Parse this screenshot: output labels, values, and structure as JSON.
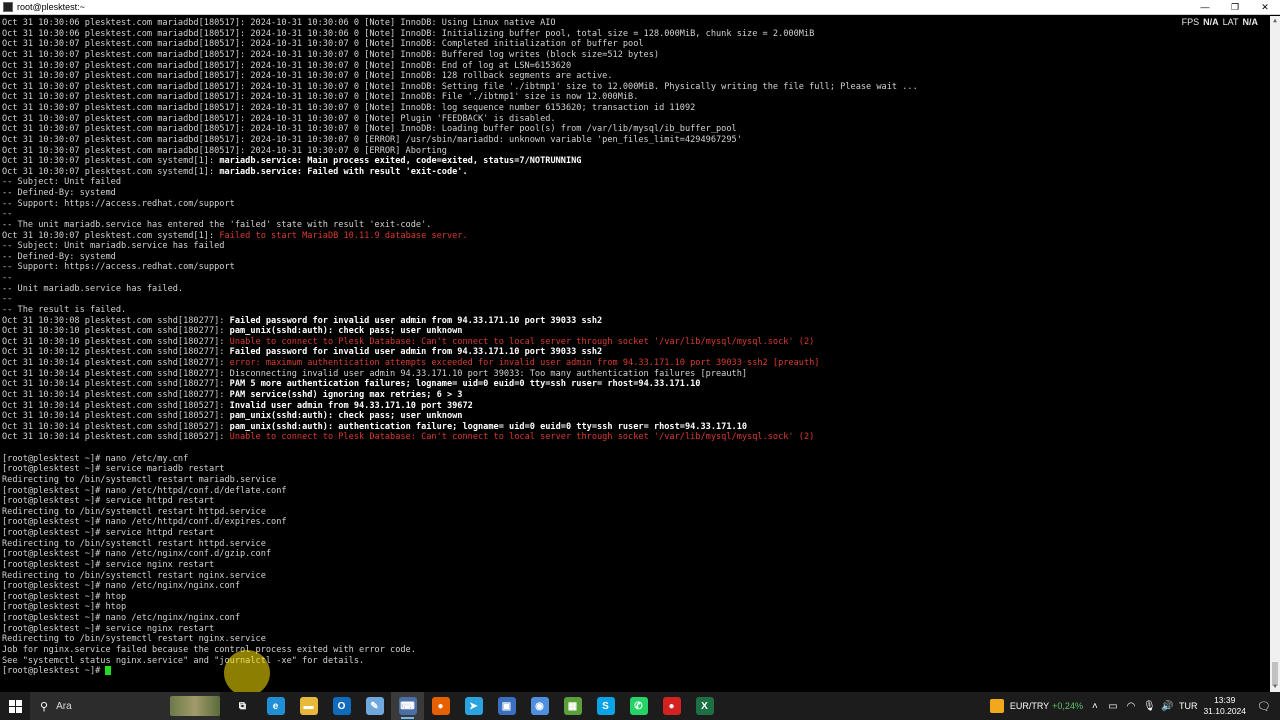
{
  "window": {
    "title": "root@plesktest:~",
    "minimize_glyph": "—",
    "maximize_glyph": "❐",
    "close_glyph": "✕"
  },
  "overlay": {
    "fps_label": "FPS",
    "fps_value": "N/A",
    "lat_label": "LAT",
    "lat_value": "N/A"
  },
  "terminal": {
    "lines": [
      [
        [
          "Oct 31 10:30:06 plesktest.com mariadbd[180517]: 2024-10-31 10:30:06 0 [Note] InnoDB: Using Linux native AIO",
          "n"
        ]
      ],
      [
        [
          "Oct 31 10:30:06 plesktest.com mariadbd[180517]: 2024-10-31 10:30:06 0 [Note] InnoDB: Initializing buffer pool, total size = 128.000MiB, chunk size = 2.000MiB",
          "n"
        ]
      ],
      [
        [
          "Oct 31 10:30:07 plesktest.com mariadbd[180517]: 2024-10-31 10:30:07 0 [Note] InnoDB: Completed initialization of buffer pool",
          "n"
        ]
      ],
      [
        [
          "Oct 31 10:30:07 plesktest.com mariadbd[180517]: 2024-10-31 10:30:07 0 [Note] InnoDB: Buffered log writes (block size=512 bytes)",
          "n"
        ]
      ],
      [
        [
          "Oct 31 10:30:07 plesktest.com mariadbd[180517]: 2024-10-31 10:30:07 0 [Note] InnoDB: End of log at LSN=6153620",
          "n"
        ]
      ],
      [
        [
          "Oct 31 10:30:07 plesktest.com mariadbd[180517]: 2024-10-31 10:30:07 0 [Note] InnoDB: 128 rollback segments are active.",
          "n"
        ]
      ],
      [
        [
          "Oct 31 10:30:07 plesktest.com mariadbd[180517]: 2024-10-31 10:30:07 0 [Note] InnoDB: Setting file './ibtmp1' size to 12.000MiB. Physically writing the file full; Please wait ...",
          "n"
        ]
      ],
      [
        [
          "Oct 31 10:30:07 plesktest.com mariadbd[180517]: 2024-10-31 10:30:07 0 [Note] InnoDB: File './ibtmp1' size is now 12.000MiB.",
          "n"
        ]
      ],
      [
        [
          "Oct 31 10:30:07 plesktest.com mariadbd[180517]: 2024-10-31 10:30:07 0 [Note] InnoDB: log sequence number 6153620; transaction id 11092",
          "n"
        ]
      ],
      [
        [
          "Oct 31 10:30:07 plesktest.com mariadbd[180517]: 2024-10-31 10:30:07 0 [Note] Plugin 'FEEDBACK' is disabled.",
          "n"
        ]
      ],
      [
        [
          "Oct 31 10:30:07 plesktest.com mariadbd[180517]: 2024-10-31 10:30:07 0 [Note] InnoDB: Loading buffer pool(s) from /var/lib/mysql/ib_buffer_pool",
          "n"
        ]
      ],
      [
        [
          "Oct 31 10:30:07 plesktest.com mariadbd[180517]: 2024-10-31 10:30:07 0 [ERROR] /usr/sbin/mariadbd: unknown variable 'pen_files_limit=4294967295'",
          "n"
        ]
      ],
      [
        [
          "Oct 31 10:30:07 plesktest.com mariadbd[180517]: 2024-10-31 10:30:07 0 [ERROR] Aborting",
          "n"
        ]
      ],
      [
        [
          "Oct 31 10:30:07 plesktest.com systemd[1]: ",
          "n"
        ],
        [
          "mariadb.service: Main process exited, code=exited, status=7/NOTRUNNING",
          "b"
        ]
      ],
      [
        [
          "Oct 31 10:30:07 plesktest.com systemd[1]: ",
          "n"
        ],
        [
          "mariadb.service: Failed with result 'exit-code'.",
          "b"
        ]
      ],
      [
        [
          "-- Subject: Unit failed",
          "n"
        ]
      ],
      [
        [
          "-- Defined-By: systemd",
          "n"
        ]
      ],
      [
        [
          "-- Support: https://access.redhat.com/support",
          "n"
        ]
      ],
      [
        [
          "--",
          "n"
        ]
      ],
      [
        [
          "-- The unit mariadb.service has entered the 'failed' state with result 'exit-code'.",
          "n"
        ]
      ],
      [
        [
          "Oct 31 10:30:07 plesktest.com systemd[1]: ",
          "n"
        ],
        [
          "Failed to start MariaDB 10.11.9 database server.",
          "r"
        ]
      ],
      [
        [
          "-- Subject: Unit mariadb.service has failed",
          "n"
        ]
      ],
      [
        [
          "-- Defined-By: systemd",
          "n"
        ]
      ],
      [
        [
          "-- Support: https://access.redhat.com/support",
          "n"
        ]
      ],
      [
        [
          "--",
          "n"
        ]
      ],
      [
        [
          "-- Unit mariadb.service has failed.",
          "n"
        ]
      ],
      [
        [
          "--",
          "n"
        ]
      ],
      [
        [
          "-- The result is failed.",
          "n"
        ]
      ],
      [
        [
          "Oct 31 10:30:08 plesktest.com sshd[180277]: ",
          "n"
        ],
        [
          "Failed password for invalid user admin from 94.33.171.10 port 39033 ssh2",
          "b"
        ]
      ],
      [
        [
          "Oct 31 10:30:10 plesktest.com sshd[180277]: ",
          "n"
        ],
        [
          "pam_unix(sshd:auth): check pass; user unknown",
          "b"
        ]
      ],
      [
        [
          "Oct 31 10:30:10 plesktest.com sshd[180277]: ",
          "n"
        ],
        [
          "Unable to connect to Plesk Database: Can't connect to local server through socket '/var/lib/mysql/mysql.sock' (2)",
          "r"
        ]
      ],
      [
        [
          "Oct 31 10:30:12 plesktest.com sshd[180277]: ",
          "n"
        ],
        [
          "Failed password for invalid user admin from 94.33.171.10 port 39033 ssh2",
          "b"
        ]
      ],
      [
        [
          "Oct 31 10:30:14 plesktest.com sshd[180277]: ",
          "n"
        ],
        [
          "error: maximum authentication attempts exceeded for invalid user admin from 94.33.171.10 port 39033 ssh2 [preauth]",
          "r"
        ]
      ],
      [
        [
          "Oct 31 10:30:14 plesktest.com sshd[180277]: Disconnecting invalid user admin 94.33.171.10 port 39033: Too many authentication failures [preauth]",
          "n"
        ]
      ],
      [
        [
          "Oct 31 10:30:14 plesktest.com sshd[180277]: ",
          "n"
        ],
        [
          "PAM 5 more authentication failures; logname= uid=0 euid=0 tty=ssh ruser= rhost=94.33.171.10",
          "b"
        ]
      ],
      [
        [
          "Oct 31 10:30:14 plesktest.com sshd[180277]: ",
          "n"
        ],
        [
          "PAM service(sshd) ignoring max retries; 6 > 3",
          "b"
        ]
      ],
      [
        [
          "Oct 31 10:30:14 plesktest.com sshd[180527]: ",
          "n"
        ],
        [
          "Invalid user admin from 94.33.171.10 port 39672",
          "b"
        ]
      ],
      [
        [
          "Oct 31 10:30:14 plesktest.com sshd[180527]: ",
          "n"
        ],
        [
          "pam_unix(sshd:auth): check pass; user unknown",
          "b"
        ]
      ],
      [
        [
          "Oct 31 10:30:14 plesktest.com sshd[180527]: ",
          "n"
        ],
        [
          "pam_unix(sshd:auth): authentication failure; logname= uid=0 euid=0 tty=ssh ruser= rhost=94.33.171.10",
          "b"
        ]
      ],
      [
        [
          "Oct 31 10:30:14 plesktest.com sshd[180527]: ",
          "n"
        ],
        [
          "Unable to connect to Plesk Database: Can't connect to local server through socket '/var/lib/mysql/mysql.sock' (2)",
          "r"
        ]
      ],
      [
        [
          "",
          "n"
        ]
      ],
      [
        [
          "[root@plesktest ~]# nano /etc/my.cnf",
          "n"
        ]
      ],
      [
        [
          "[root@plesktest ~]# service mariadb restart",
          "n"
        ]
      ],
      [
        [
          "Redirecting to /bin/systemctl restart mariadb.service",
          "n"
        ]
      ],
      [
        [
          "[root@plesktest ~]# nano /etc/httpd/conf.d/deflate.conf",
          "n"
        ]
      ],
      [
        [
          "[root@plesktest ~]# service httpd restart",
          "n"
        ]
      ],
      [
        [
          "Redirecting to /bin/systemctl restart httpd.service",
          "n"
        ]
      ],
      [
        [
          "[root@plesktest ~]# nano /etc/httpd/conf.d/expires.conf",
          "n"
        ]
      ],
      [
        [
          "[root@plesktest ~]# service httpd restart",
          "n"
        ]
      ],
      [
        [
          "Redirecting to /bin/systemctl restart httpd.service",
          "n"
        ]
      ],
      [
        [
          "[root@plesktest ~]# nano /etc/nginx/conf.d/gzip.conf",
          "n"
        ]
      ],
      [
        [
          "[root@plesktest ~]# service nginx restart",
          "n"
        ]
      ],
      [
        [
          "Redirecting to /bin/systemctl restart nginx.service",
          "n"
        ]
      ],
      [
        [
          "[root@plesktest ~]# nano /etc/nginx/nginx.conf",
          "n"
        ]
      ],
      [
        [
          "[root@plesktest ~]# htop",
          "n"
        ]
      ],
      [
        [
          "[root@plesktest ~]# htop",
          "n"
        ]
      ],
      [
        [
          "[root@plesktest ~]# nano /etc/nginx/nginx.conf",
          "n"
        ]
      ],
      [
        [
          "[root@plesktest ~]# service nginx restart",
          "n"
        ]
      ],
      [
        [
          "Redirecting to /bin/systemctl restart nginx.service",
          "n"
        ]
      ],
      [
        [
          "Job for nginx.service failed because the control process exited with error code.",
          "n"
        ]
      ],
      [
        [
          "See \"systemctl status nginx.service\" and \"journalctl -xe\" for details.",
          "n"
        ]
      ]
    ],
    "prompt": "[root@plesktest ~]# "
  },
  "taskbar": {
    "search_placeholder": "Ara",
    "apps": [
      {
        "name": "task-view-icon",
        "glyph": "⧉",
        "color": "#1c1c1c",
        "state": ""
      },
      {
        "name": "edge-icon",
        "glyph": "e",
        "color": "#1f8fd6",
        "state": ""
      },
      {
        "name": "file-explorer-icon",
        "glyph": "▬",
        "color": "#e8b83a",
        "state": ""
      },
      {
        "name": "outlook-icon",
        "glyph": "O",
        "color": "#0f6cbd",
        "state": ""
      },
      {
        "name": "notepad-icon",
        "glyph": "✎",
        "color": "#6fa8dc",
        "state": ""
      },
      {
        "name": "putty-icon",
        "glyph": "⌨",
        "color": "#4a6fa5",
        "state": "active running"
      },
      {
        "name": "firefox-icon",
        "glyph": "●",
        "color": "#e66000",
        "state": ""
      },
      {
        "name": "telegram-icon",
        "glyph": "➤",
        "color": "#2aa3df",
        "state": ""
      },
      {
        "name": "app-icon-blue",
        "glyph": "▣",
        "color": "#3b6fbf",
        "state": ""
      },
      {
        "name": "app-icon-round",
        "glyph": "◉",
        "color": "#4e8fe0",
        "state": ""
      },
      {
        "name": "calculator-icon",
        "glyph": "▦",
        "color": "#5a9f3a",
        "state": ""
      },
      {
        "name": "skype-icon",
        "glyph": "S",
        "color": "#0aa4e6",
        "state": ""
      },
      {
        "name": "whatsapp-icon",
        "glyph": "✆",
        "color": "#25d366",
        "state": ""
      },
      {
        "name": "record-icon",
        "glyph": "●",
        "color": "#d22222",
        "state": ""
      },
      {
        "name": "excel-icon",
        "glyph": "X",
        "color": "#1d7044",
        "state": ""
      }
    ],
    "currency_pair": "EUR/TRY",
    "currency_change": "+0,24%",
    "language": "TUR",
    "time": "13:39",
    "date": "31.10.2024"
  }
}
